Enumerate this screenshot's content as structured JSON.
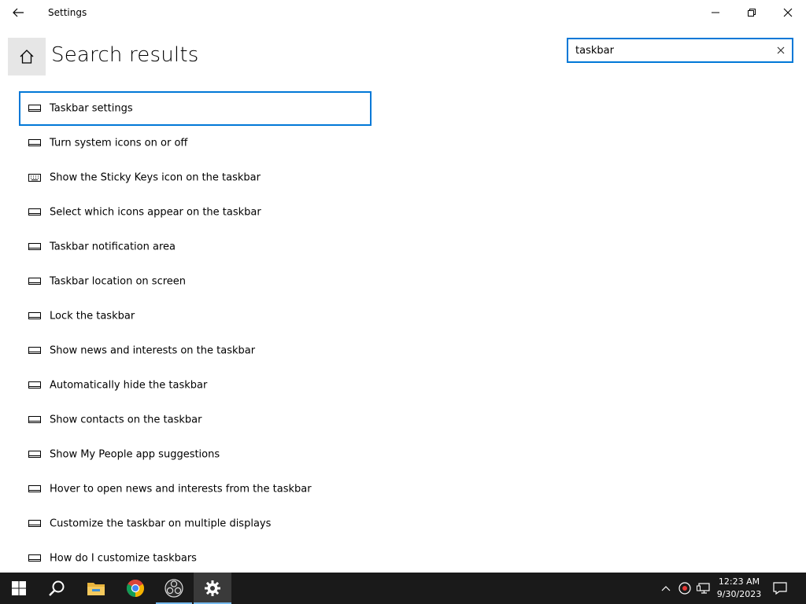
{
  "window": {
    "title": "Settings"
  },
  "header": {
    "title": "Search results"
  },
  "search": {
    "value": "taskbar",
    "placeholder": ""
  },
  "results": [
    {
      "label": "Taskbar settings",
      "icon": "display-icon",
      "selected": true
    },
    {
      "label": "Turn system icons on or off",
      "icon": "display-icon"
    },
    {
      "label": "Show the Sticky Keys icon on the taskbar",
      "icon": "keyboard-icon"
    },
    {
      "label": "Select which icons appear on the taskbar",
      "icon": "display-icon"
    },
    {
      "label": "Taskbar notification area",
      "icon": "display-icon"
    },
    {
      "label": "Taskbar location on screen",
      "icon": "display-icon"
    },
    {
      "label": "Lock the taskbar",
      "icon": "display-icon"
    },
    {
      "label": "Show news and interests on the taskbar",
      "icon": "display-icon"
    },
    {
      "label": "Automatically hide the taskbar",
      "icon": "display-icon"
    },
    {
      "label": "Show contacts on the taskbar",
      "icon": "display-icon"
    },
    {
      "label": "Show My People app suggestions",
      "icon": "display-icon"
    },
    {
      "label": "Hover to open news and interests from the taskbar",
      "icon": "display-icon"
    },
    {
      "label": "Customize the taskbar on multiple displays",
      "icon": "display-icon"
    },
    {
      "label": "How do I customize taskbars",
      "icon": "display-icon"
    }
  ],
  "taskbar": {
    "apps": [
      "start-icon",
      "search-icon",
      "file-explorer-icon",
      "chrome-icon",
      "obs-icon",
      "settings-gear-icon"
    ],
    "clock": {
      "time": "12:23 AM",
      "date": "9/30/2023"
    }
  },
  "colors": {
    "accent": "#0078d7",
    "taskbar": "#1a1a1a",
    "home_button_bg": "#e6e6e6"
  }
}
